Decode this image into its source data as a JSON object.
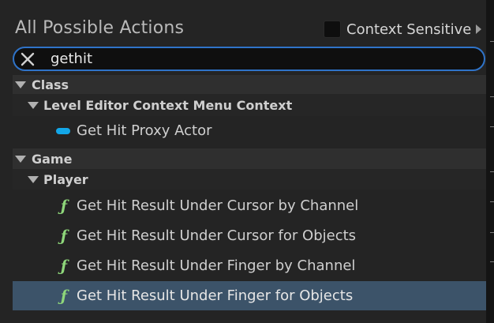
{
  "header": {
    "title": "All Possible Actions",
    "context_label": "Context Sensitive"
  },
  "search": {
    "value": "gethit",
    "clear_icon": "close-icon"
  },
  "tree": {
    "class_category": "Class",
    "level_editor_subcategory": "Level Editor Context Menu Context",
    "get_hit_proxy_actor": "Get Hit Proxy Actor",
    "game_category": "Game",
    "player_subcategory": "Player",
    "actions": [
      "Get Hit Result Under Cursor by Channel",
      "Get Hit Result Under Cursor for Objects",
      "Get Hit Result Under Finger by Channel",
      "Get Hit Result Under Finger for Objects"
    ],
    "function_glyph": "ƒ"
  },
  "colors": {
    "accent": "#2f73c8",
    "selected_row": "#3c5369",
    "variable_pill": "#13a7e8",
    "function_icon": "#8ed67a"
  }
}
